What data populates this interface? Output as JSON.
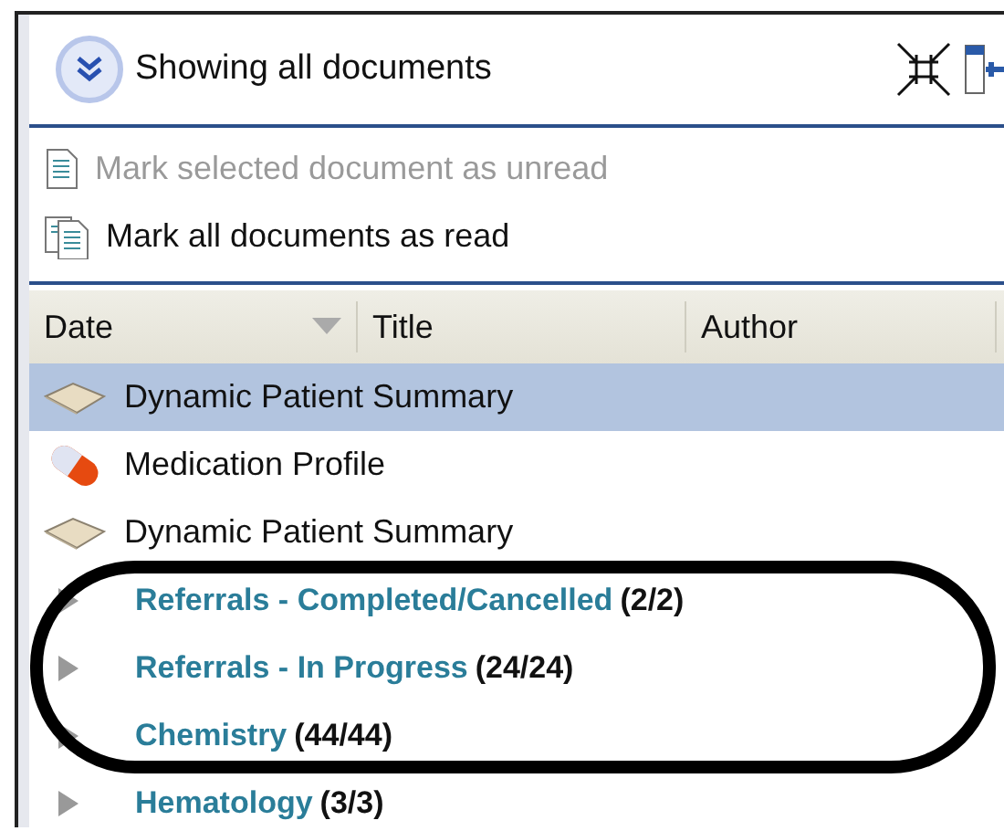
{
  "header": {
    "title": "Showing all documents"
  },
  "actions": [
    {
      "label": "Mark selected document as unread",
      "disabled": true
    },
    {
      "label": "Mark all documents as read",
      "disabled": false
    }
  ],
  "table": {
    "columns": [
      {
        "label": "Date",
        "sorted": true
      },
      {
        "label": "Title",
        "sorted": false
      },
      {
        "label": "Author",
        "sorted": false
      }
    ]
  },
  "tree": [
    {
      "kind": "document",
      "label": "Dynamic Patient Summary",
      "selected": true
    },
    {
      "kind": "medication",
      "label": "Medication Profile",
      "selected": false
    },
    {
      "kind": "document",
      "label": "Dynamic Patient Summary",
      "selected": false
    },
    {
      "kind": "group",
      "label": "Referrals - Completed/Cancelled",
      "count": "(2/2)",
      "expanded": false,
      "selected": false
    },
    {
      "kind": "group",
      "label": "Referrals - In Progress",
      "count": "(24/24)",
      "expanded": false,
      "selected": false
    },
    {
      "kind": "group",
      "label": "Chemistry",
      "count": "(44/44)",
      "expanded": false,
      "selected": false
    },
    {
      "kind": "group",
      "label": "Hematology",
      "count": "(3/3)",
      "expanded": false,
      "selected": false
    }
  ]
}
